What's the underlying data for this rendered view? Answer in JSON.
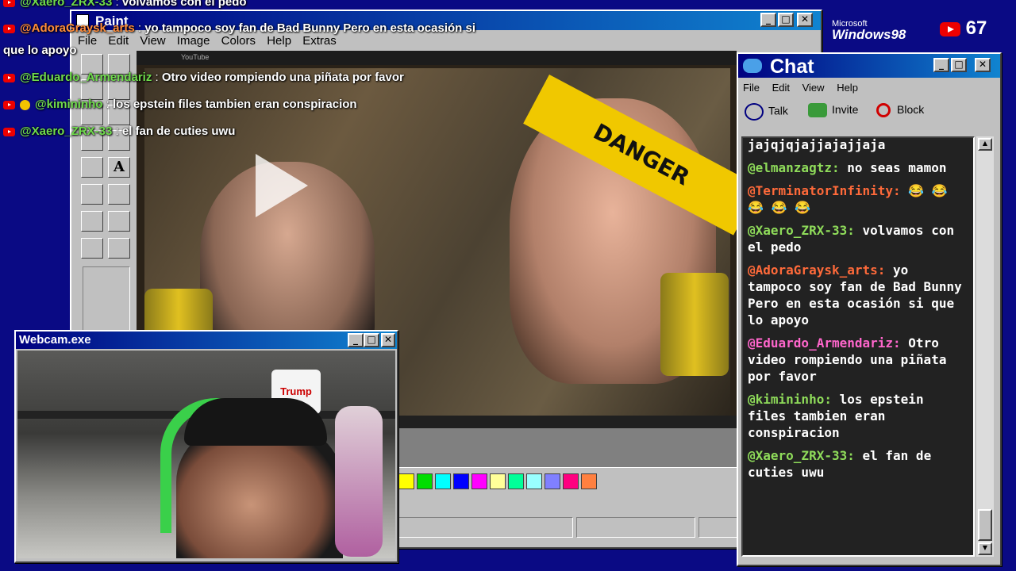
{
  "overlay_chat": [
    {
      "user": "@Xaero_ZRX-33",
      "message": "volvamos con el pedo",
      "user_color": "green"
    },
    {
      "user": "@AdoraGraysk_arts",
      "message": "yo tampoco soy fan de Bad Bunny Pero en esta ocasión si",
      "message2": "que lo apoyo",
      "user_color": "orange"
    },
    {
      "user": "@Eduardo_Armendariz",
      "message": "Otro video rompiendo una piñata por favor",
      "user_color": "green"
    },
    {
      "user": "@kimininho",
      "message": "los epstein files tambien eran conspiracion",
      "user_color": "green"
    },
    {
      "user": "@Xaero_ZRX-33",
      "message": "el fan de cuties uwu",
      "user_color": "green"
    }
  ],
  "paint": {
    "title": "Paint",
    "menu": [
      "File",
      "Edit",
      "View",
      "Image",
      "Colors",
      "Help",
      "Extras"
    ],
    "palette": [
      "#ffff00",
      "#00dd00",
      "#00ffff",
      "#0000ff",
      "#ff00ff",
      "#ffff99",
      "#00ff99",
      "#99ffff",
      "#8080ff",
      "#ff0080",
      "#ff8040"
    ]
  },
  "video": {
    "danger_label": "DANGER",
    "tab_label": "YouTube"
  },
  "branding": {
    "microsoft": "Microsoft",
    "windows": "Windows98",
    "viewer_count": "67"
  },
  "webcam": {
    "title": "Webcam.exe",
    "mug_text": "Trump"
  },
  "chat_window": {
    "title": "Chat",
    "menu": [
      "File",
      "Edit",
      "View",
      "Help"
    ],
    "toolbar": {
      "talk": "Talk",
      "invite": "Invite",
      "block": "Block"
    },
    "messages": [
      {
        "user": "",
        "text": "jajqjqjajjajajjaja",
        "color": "#ffffff"
      },
      {
        "user": "@elmanzagtz:",
        "text": "no seas mamon",
        "color": "#8fdc5a"
      },
      {
        "user": "@TerminatorInfinity:",
        "text": "😂 😂 😂 😂 😂",
        "color": "#ff6a3a"
      },
      {
        "user": "@Xaero_ZRX-33:",
        "text": "volvamos con el pedo",
        "color": "#8fdc5a"
      },
      {
        "user": "@AdoraGraysk_arts:",
        "text": "yo tampoco soy fan de Bad Bunny Pero en esta ocasión si que lo apoyo",
        "color": "#ff6a3a"
      },
      {
        "user": "@Eduardo_Armendariz:",
        "text": "Otro video rompiendo una piñata por favor",
        "color": "#ff66cc"
      },
      {
        "user": "@kimininho:",
        "text": "los epstein files tambien eran conspiracion",
        "color": "#8fdc5a"
      },
      {
        "user": "@Xaero_ZRX-33:",
        "text": "el fan de cuties uwu",
        "color": "#8fdc5a"
      }
    ]
  },
  "colors": {
    "titlebar": "#000080",
    "desktop": "#0a0a84",
    "face": "#c0c0c0"
  }
}
